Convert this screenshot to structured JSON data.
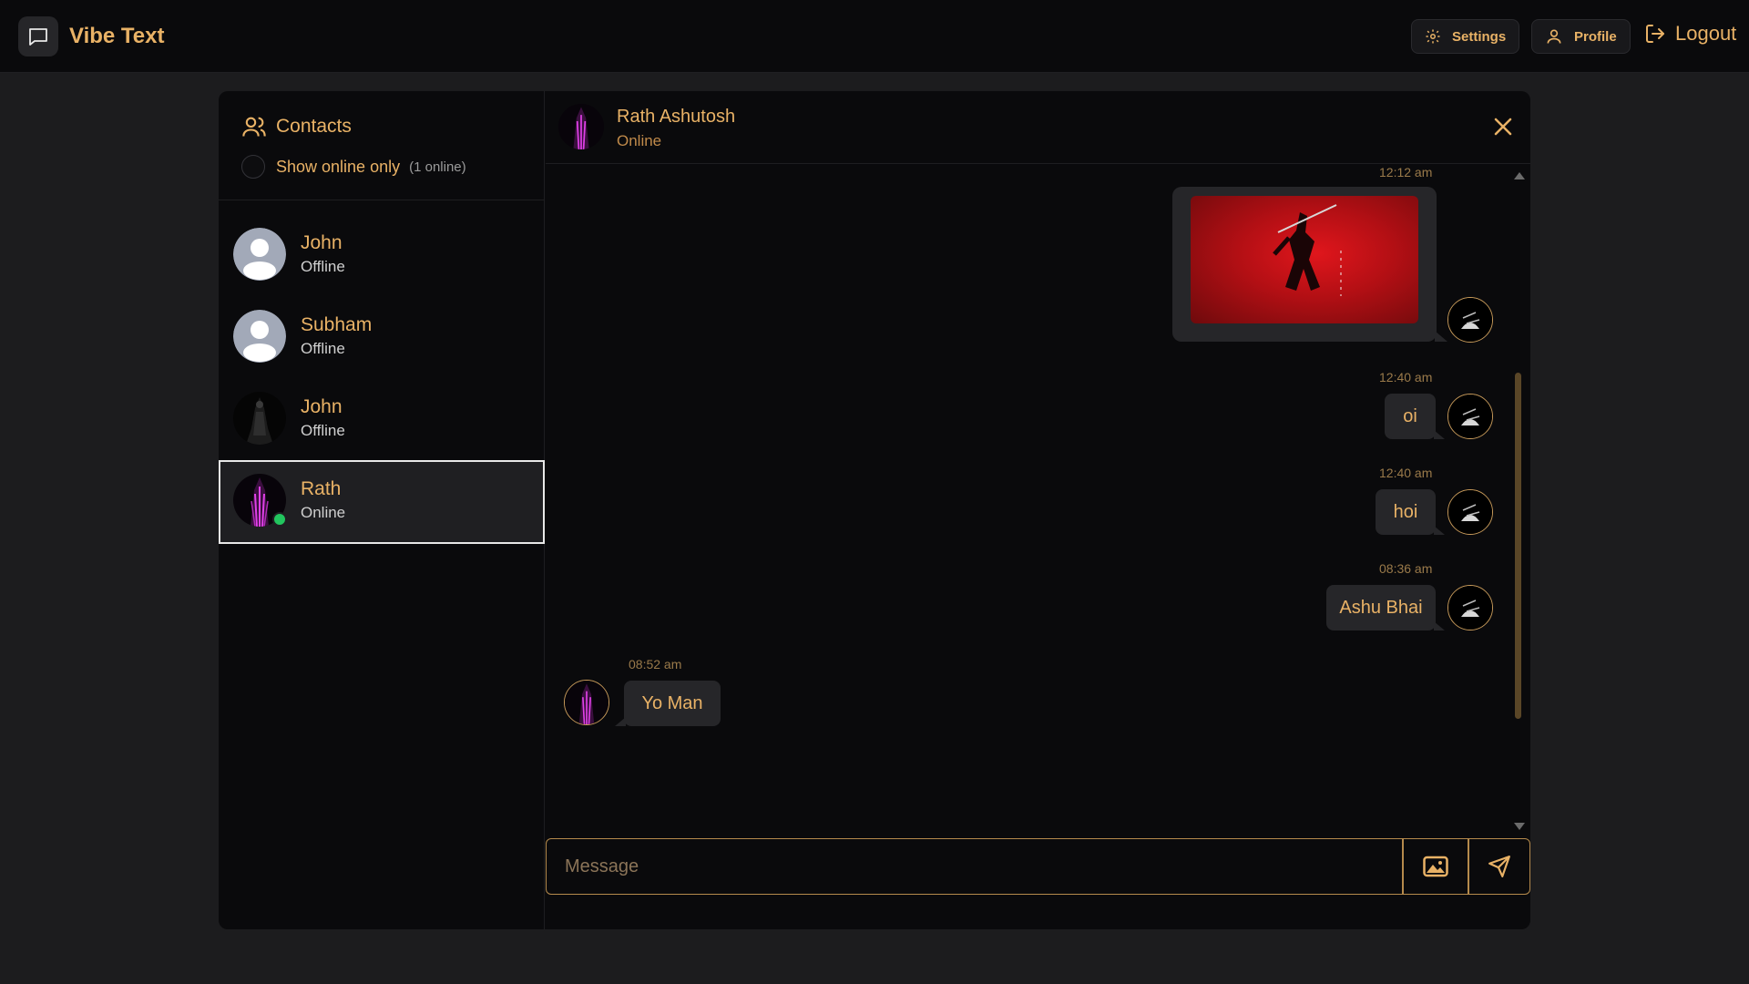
{
  "app": {
    "name": "Vibe Text"
  },
  "nav": {
    "settings_label": "Settings",
    "profile_label": "Profile",
    "logout_label": "Logout"
  },
  "sidebar": {
    "title": "Contacts",
    "filter_label": "Show online only",
    "online_count": "(1 online)",
    "contacts": [
      {
        "name": "John",
        "status": "Offline",
        "avatar": "default-user"
      },
      {
        "name": "Subham",
        "status": "Offline",
        "avatar": "default-user"
      },
      {
        "name": "John",
        "status": "Offline",
        "avatar": "dark-figure"
      },
      {
        "name": "Rath",
        "status": "Online",
        "avatar": "purple-figure",
        "selected": true
      }
    ]
  },
  "chat": {
    "name": "Rath Ashutosh",
    "status": "Online",
    "messages": [
      {
        "time": "12:12 am",
        "type": "image",
        "direction": "out"
      },
      {
        "time": "12:40 am",
        "text": "oi",
        "direction": "out"
      },
      {
        "time": "12:40 am",
        "text": "hoi",
        "direction": "out"
      },
      {
        "time": "08:36 am",
        "text": "Ashu Bhai",
        "direction": "out"
      },
      {
        "time": "08:52 am",
        "text": "Yo Man",
        "direction": "in"
      }
    ],
    "input_placeholder": "Message"
  },
  "colors": {
    "accent": "#e9b266",
    "online": "#22c55e",
    "background": "#0a0a0c",
    "bubble": "#262629"
  }
}
